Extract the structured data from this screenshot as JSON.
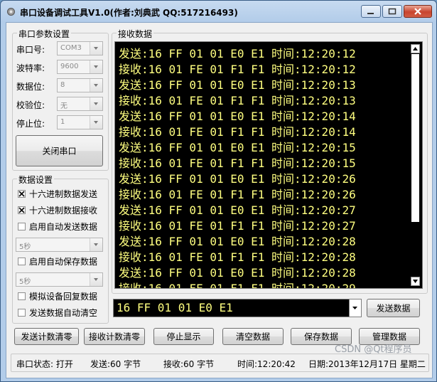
{
  "window": {
    "title": "串口设备调试工具V1.0(作者:刘典武  QQ:517216493)"
  },
  "serial_group": {
    "title": "串口参数设置",
    "fields": [
      {
        "label": "串口号:",
        "value": "COM3"
      },
      {
        "label": "波特率:",
        "value": "9600"
      },
      {
        "label": "数据位:",
        "value": "8"
      },
      {
        "label": "校验位:",
        "value": "无"
      },
      {
        "label": "停止位:",
        "value": "1"
      }
    ],
    "close_button": "关闭串口"
  },
  "data_group": {
    "title": "数据设置",
    "hex_send": {
      "label": "十六进制数据发送",
      "checked": true
    },
    "hex_recv": {
      "label": "十六进制数据接收",
      "checked": true
    },
    "auto_send": {
      "label": "启用自动发送数据",
      "checked": false
    },
    "auto_send_interval": "5秒",
    "auto_save": {
      "label": "启用自动保存数据",
      "checked": false
    },
    "auto_save_interval": "5秒",
    "simulate_reply": {
      "label": "模拟设备回复数据",
      "checked": false
    },
    "auto_clear": {
      "label": "发送数据自动清空",
      "checked": false
    }
  },
  "recv": {
    "title": "接收数据",
    "lines": [
      "发送:16 FF 01 01 E0 E1 时间:12:20:12",
      "接收:16 01 FE 01 F1 F1 时间:12:20:12",
      "发送:16 FF 01 01 E0 E1 时间:12:20:13",
      "接收:16 01 FE 01 F1 F1 时间:12:20:13",
      "发送:16 FF 01 01 E0 E1 时间:12:20:14",
      "接收:16 01 FE 01 F1 F1 时间:12:20:14",
      "发送:16 FF 01 01 E0 E1 时间:12:20:15",
      "接收:16 01 FE 01 F1 F1 时间:12:20:15",
      "发送:16 FF 01 01 E0 E1 时间:12:20:26",
      "接收:16 01 FE 01 F1 F1 时间:12:20:26",
      "发送:16 FF 01 01 E0 E1 时间:12:20:27",
      "接收:16 01 FE 01 F1 F1 时间:12:20:27",
      "发送:16 FF 01 01 E0 E1 时间:12:20:28",
      "接收:16 01 FE 01 F1 F1 时间:12:20:28",
      "发送:16 FF 01 01 E0 E1 时间:12:20:28",
      "接收:16 01 FE 01 F1 F1 时间:12:20:29"
    ]
  },
  "send": {
    "value": "16 FF 01 01 E0 E1",
    "button": "发送数据"
  },
  "actions": [
    "发送计数清零",
    "接收计数清零",
    "停止显示",
    "清空数据",
    "保存数据",
    "管理数据"
  ],
  "status": {
    "port": "串口状态: 打开",
    "sent": "发送:60 字节",
    "recv": "接收:60 字节",
    "time": "时间:12:20:42",
    "date": "日期:2013年12月17日 星期二"
  },
  "watermark": "CSDN @Qt程序员",
  "colors": {
    "console_bg": "#000000",
    "console_text": "#ffff80"
  }
}
